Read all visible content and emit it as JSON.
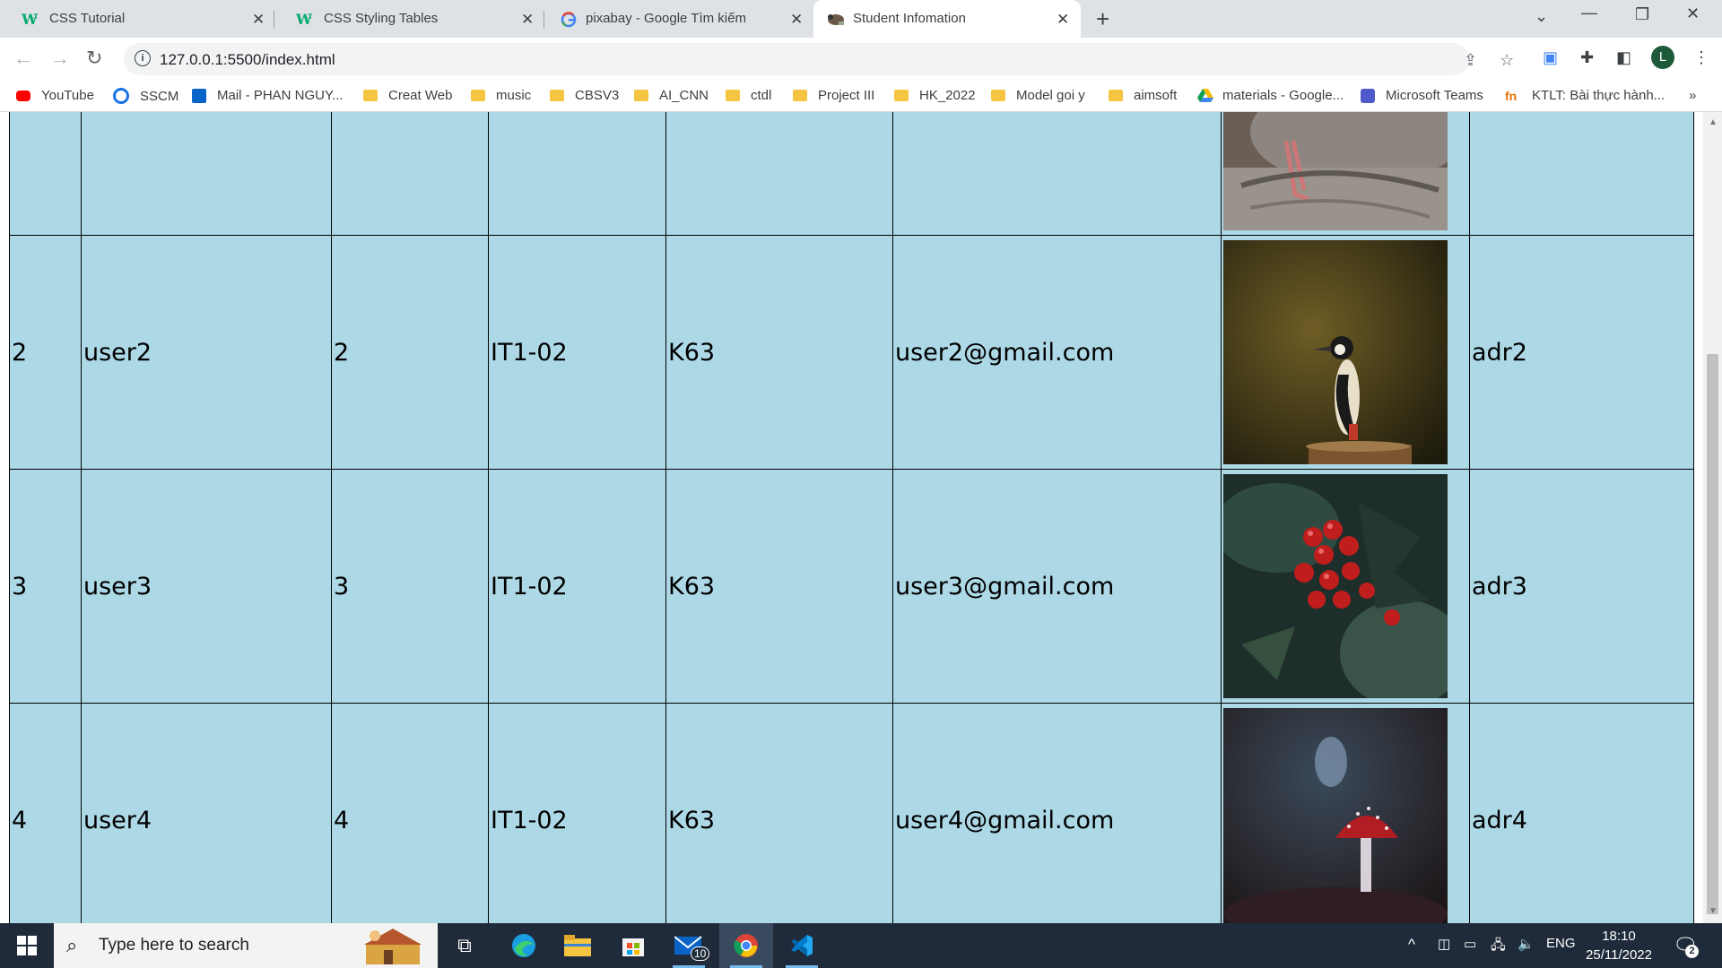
{
  "browser": {
    "tabs": [
      {
        "title": "CSS Tutorial",
        "icon": "w3schools-icon"
      },
      {
        "title": "CSS Styling Tables",
        "icon": "w3schools-icon"
      },
      {
        "title": "pixabay - Google Tìm kiếm",
        "icon": "google-icon"
      },
      {
        "title": "Student Infomation",
        "icon": "page-icon",
        "active": true
      }
    ],
    "url": "127.0.0.1:5500/index.html",
    "bookmarks": [
      {
        "label": "YouTube",
        "icon": "youtube-icon"
      },
      {
        "label": "SSCM",
        "icon": "sscm-icon"
      },
      {
        "label": "Mail - PHAN NGUY...",
        "icon": "outlook-icon"
      },
      {
        "label": "Creat Web",
        "icon": "folder-icon"
      },
      {
        "label": "music",
        "icon": "folder-icon"
      },
      {
        "label": "CBSV3",
        "icon": "folder-icon"
      },
      {
        "label": "AI_CNN",
        "icon": "folder-icon"
      },
      {
        "label": "ctdl",
        "icon": "folder-icon"
      },
      {
        "label": "Project III",
        "icon": "folder-icon"
      },
      {
        "label": "HK_2022",
        "icon": "folder-icon"
      },
      {
        "label": "Model goi y",
        "icon": "folder-icon"
      },
      {
        "label": "aimsoft",
        "icon": "folder-icon"
      },
      {
        "label": "materials - Google...",
        "icon": "drive-icon"
      },
      {
        "label": "Microsoft Teams",
        "icon": "teams-icon"
      },
      {
        "label": "KTLT: Bài thực hành...",
        "icon": "bookmark-icon"
      }
    ],
    "more_bookmarks": "»",
    "profile_initial": "L"
  },
  "students": [
    {
      "id": "",
      "name": "",
      "num": "",
      "class": "",
      "course": "",
      "email": "",
      "address": "",
      "photo": "bird-feet-photo"
    },
    {
      "id": "2",
      "name": "user2",
      "num": "2",
      "class": "IT1-02",
      "course": "K63",
      "email": "user2@gmail.com",
      "address": "adr2",
      "photo": "woodpecker-photo"
    },
    {
      "id": "3",
      "name": "user3",
      "num": "3",
      "class": "IT1-02",
      "course": "K63",
      "email": "user3@gmail.com",
      "address": "adr3",
      "photo": "holly-berries-photo"
    },
    {
      "id": "4",
      "name": "user4",
      "num": "4",
      "class": "IT1-02",
      "course": "K63",
      "email": "user4@gmail.com",
      "address": "adr4",
      "photo": "mushroom-photo"
    }
  ],
  "colors": {
    "table_bg": "#add8e6",
    "taskbar": "#1f2b3a"
  },
  "taskbar": {
    "search_placeholder": "Type here to search",
    "mail_badge": "10",
    "language": "ENG",
    "time": "18:10",
    "date": "25/11/2022",
    "notification_count": "2"
  }
}
